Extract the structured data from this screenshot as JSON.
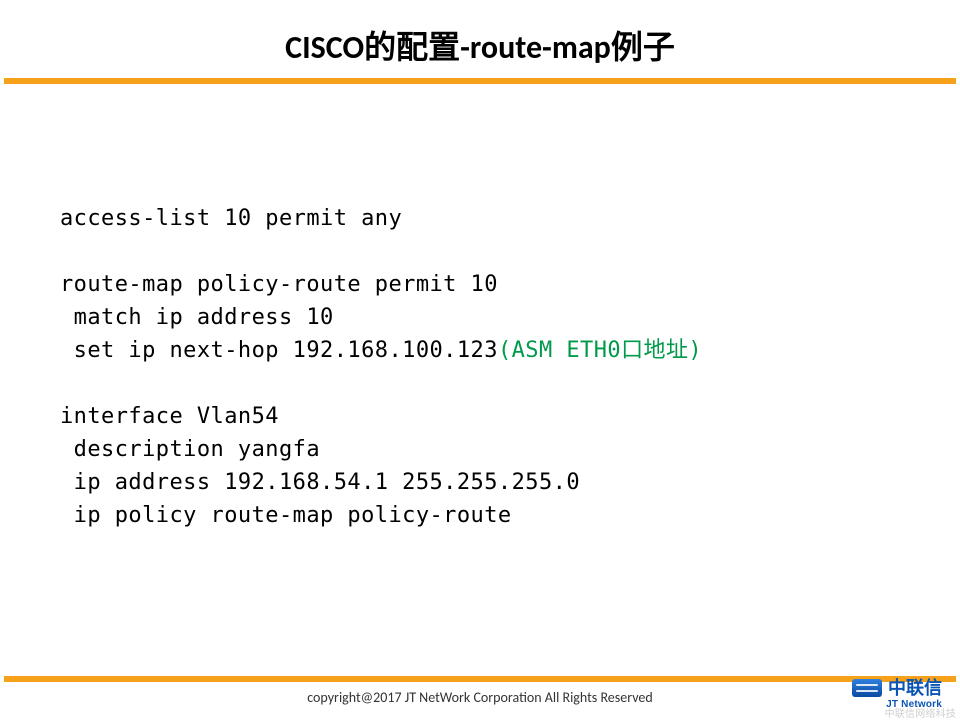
{
  "title": "CISCO的配置-route-map例子",
  "code": {
    "l1": "access-list 10 permit any",
    "l2": "",
    "l3": "route-map policy-route permit 10",
    "l4": " match ip address 10",
    "l5a": " set ip next-hop 192.168.100.123",
    "l5b": "(ASM ETH0口地址)",
    "l6": "",
    "l7": "interface Vlan54",
    "l8": " description yangfa",
    "l9": " ip address 192.168.54.1 255.255.255.0",
    "l10": " ip policy route-map policy-route"
  },
  "footer": {
    "copyright": "copyright@2017  JT NetWork Corporation All Rights Reserved",
    "logo_cn": "中联信",
    "logo_en": "JT Network",
    "watermark": "中联信网络科技"
  }
}
